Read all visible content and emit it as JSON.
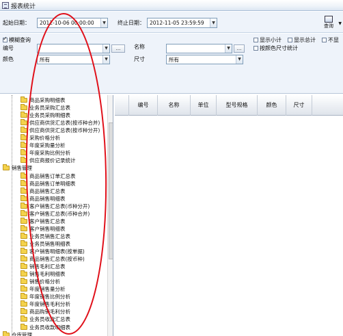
{
  "window": {
    "title": "报表统计"
  },
  "toolbar": {
    "start_label": "起始日期：",
    "start_value": "2012-10-06 00:00:00",
    "end_label": "终止日期：",
    "end_value": "2012-11-05 23:59:59",
    "query_label": "查询"
  },
  "filters": {
    "fuzzy_label": "模糊查询",
    "code_label": "编号",
    "code_value": "",
    "color_label": "颜色",
    "color_value": "所有",
    "name_label": "名称",
    "name_value": "",
    "size_label": "尺寸",
    "size_value": "所有",
    "show_subtotal": "显示小计",
    "show_total": "显示总计",
    "cutoff": "不显",
    "by_color_size": "按颜色尺寸统计",
    "ellipsis": "..."
  },
  "tree": {
    "items": [
      "商品采购明细表",
      "业务员采购汇总表",
      "业务员采购明细表",
      "供应商供货汇总表(按币种合并)",
      "供应商供货汇总表(按币种分开)",
      "采购价格分析",
      "年度采购量分析",
      "年度采购比例分析",
      "供应商报价记录统计",
      "销售管理",
      "商品销售订单汇总表",
      "商品销售订单明细表",
      "商品销售汇总表",
      "商品销售明细表",
      "客户销售汇总表(币种分开)",
      "客户销售汇总表(币种合并)",
      "客户销售汇总表",
      "客户销售明细表",
      "业务员销售汇总表",
      "业务员销售明细表",
      "客户销售明细表(按单据)",
      "商品销售汇总表(按币种)",
      "销售毛利汇总表",
      "销售毛利明细表",
      "销售价格分析",
      "年度销售量分析",
      "年度销售比例分析",
      "年度销售毛利分析",
      "商品购销毛利分析",
      "业务员收款汇总表",
      "业务员收款明细表",
      "仓库管理"
    ]
  },
  "grid": {
    "columns": [
      "编号",
      "名称",
      "单位",
      "型号规格",
      "颜色",
      "尺寸"
    ]
  },
  "colors": {
    "annotation": "#e0101a",
    "folder": "#f4d24c",
    "toolbar_bg": "#eef3fa"
  }
}
